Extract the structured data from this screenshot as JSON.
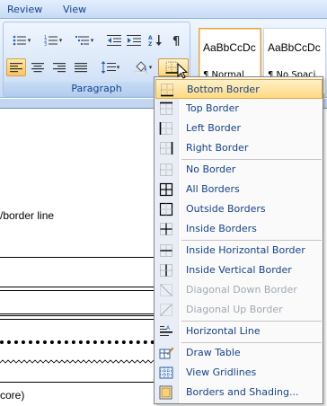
{
  "tabs": [
    {
      "label": "Review"
    },
    {
      "label": "View"
    }
  ],
  "ribbon": {
    "paragraph_label": "Paragraph",
    "buttons_row1": [
      "bullets-icon",
      "numbering-icon",
      "multilevel-list-icon",
      "decrease-indent-icon",
      "increase-indent-icon",
      "sort-icon",
      "show-marks-icon"
    ],
    "buttons_row2": [
      "align-left-icon",
      "center-icon",
      "align-right-icon",
      "justify-icon",
      "line-spacing-icon",
      "shading-icon",
      "borders-icon"
    ],
    "styles": [
      {
        "sample": "AaBbCcDc",
        "name": "¶ Normal"
      },
      {
        "sample": "AaBbCcDc",
        "name": "¶ No Spaci..."
      }
    ]
  },
  "document": {
    "line1": "/border line",
    "line2": "core)"
  },
  "menu": {
    "items": [
      {
        "label": "Bottom Border",
        "icon": "bottom-border-icon"
      },
      {
        "label": "Top Border",
        "icon": "top-border-icon"
      },
      {
        "label": "Left Border",
        "icon": "left-border-icon"
      },
      {
        "label": "Right Border",
        "icon": "right-border-icon"
      },
      {
        "label": "No Border",
        "icon": "no-border-icon"
      },
      {
        "label": "All Borders",
        "icon": "all-borders-icon"
      },
      {
        "label": "Outside Borders",
        "icon": "outside-borders-icon"
      },
      {
        "label": "Inside Borders",
        "icon": "inside-borders-icon"
      },
      {
        "label": "Inside Horizontal Border",
        "icon": "inside-horizontal-border-icon"
      },
      {
        "label": "Inside Vertical Border",
        "icon": "inside-vertical-border-icon"
      },
      {
        "label": "Diagonal Down Border",
        "icon": "diagonal-down-border-icon"
      },
      {
        "label": "Diagonal Up Border",
        "icon": "diagonal-up-border-icon"
      },
      {
        "label": "Horizontal Line",
        "icon": "horizontal-line-icon"
      },
      {
        "label": "Draw Table",
        "icon": "draw-table-icon"
      },
      {
        "label": "View Gridlines",
        "icon": "view-gridlines-icon"
      },
      {
        "label": "Borders and Shading...",
        "icon": "borders-shading-icon"
      }
    ]
  },
  "colors": {
    "ribbon_text": "#15428b",
    "highlight": "#fdd982",
    "disabled_text": "#a0a8b4"
  }
}
